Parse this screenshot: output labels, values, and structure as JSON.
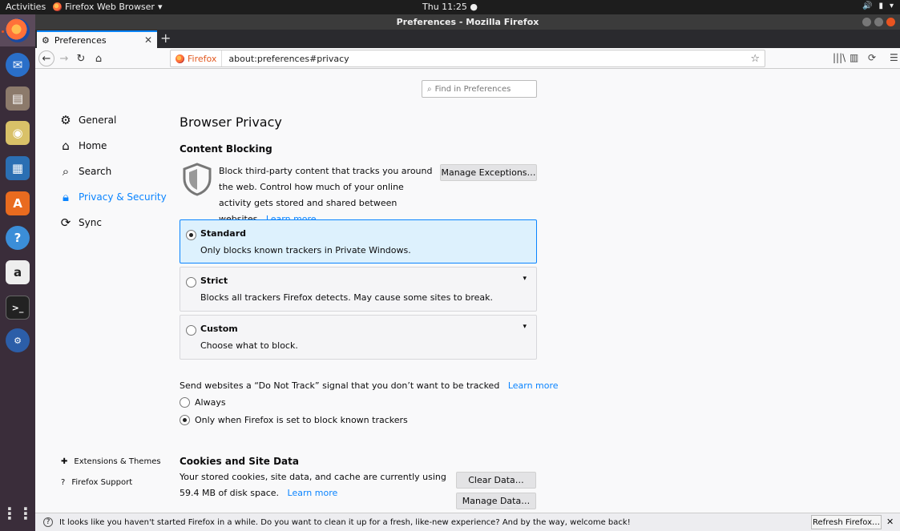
{
  "topbar": {
    "activities": "Activities",
    "app_menu": "Firefox Web Browser",
    "clock": "Thu 11:25"
  },
  "window": {
    "title": "Preferences - Mozilla Firefox"
  },
  "tab": {
    "label": "Preferences"
  },
  "urlbar": {
    "identity": "Firefox",
    "url": "about:preferences#privacy"
  },
  "find": {
    "placeholder": "Find in Preferences"
  },
  "sidebar": {
    "items": [
      {
        "label": "General",
        "icon": "gear-icon"
      },
      {
        "label": "Home",
        "icon": "home-icon"
      },
      {
        "label": "Search",
        "icon": "search-icon"
      },
      {
        "label": "Privacy & Security",
        "icon": "lock-icon",
        "selected": true
      },
      {
        "label": "Sync",
        "icon": "sync-icon"
      }
    ],
    "footer": [
      {
        "label": "Extensions & Themes",
        "icon": "puzzle-icon"
      },
      {
        "label": "Firefox Support",
        "icon": "help-icon"
      }
    ]
  },
  "main": {
    "title": "Browser Privacy",
    "content_blocking": {
      "heading": "Content Blocking",
      "description": "Block third-party content that tracks you around the web. Control how much of your online activity gets stored and shared between websites.",
      "learn_more": "Learn more",
      "manage_exceptions": "Manage Exceptions…",
      "options": [
        {
          "title": "Standard",
          "desc": "Only blocks known trackers in Private Windows.",
          "selected": true
        },
        {
          "title": "Strict",
          "desc": "Blocks all trackers Firefox detects. May cause some sites to break.",
          "selected": false
        },
        {
          "title": "Custom",
          "desc": "Choose what to block.",
          "selected": false
        }
      ]
    },
    "dnt": {
      "text": "Send websites a “Do Not Track” signal that you don’t want to be tracked",
      "learn_more": "Learn more",
      "always": "Always",
      "only_when": "Only when Firefox is set to block known trackers"
    },
    "cookies": {
      "heading": "Cookies and Site Data",
      "line1": "Your stored cookies, site data, and cache are currently using",
      "line2": "59.4 MB of disk space.",
      "learn_more": "Learn more",
      "clear_data": "Clear Data…",
      "manage_data": "Manage Data…"
    }
  },
  "notification": {
    "message": "It looks like you haven't started Firefox in a while. Do you want to clean it up for a fresh, like-new experience? And by the way, welcome back!",
    "refresh": "Refresh Firefox…"
  },
  "colors": {
    "accent": "#0a84ff",
    "ubuntu_orange": "#e95420",
    "dock": "#3a2d3a"
  }
}
